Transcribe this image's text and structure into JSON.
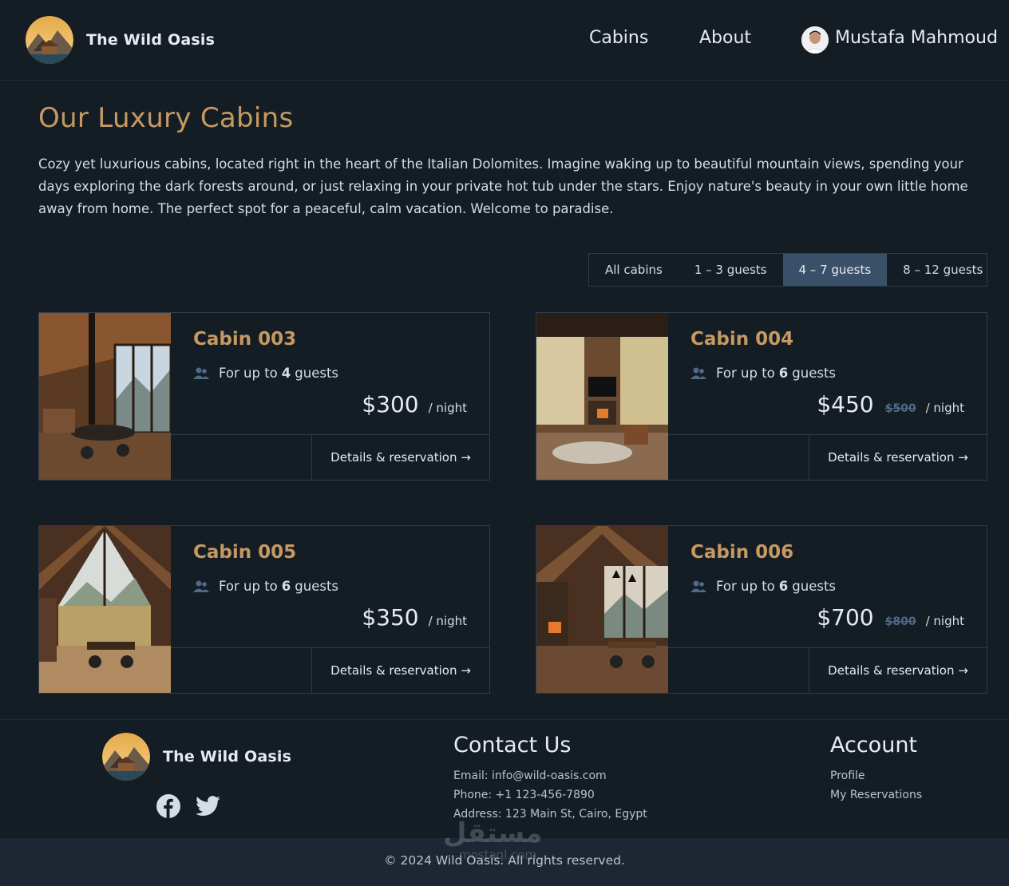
{
  "header": {
    "brand": "The Wild Oasis",
    "nav": [
      "Cabins",
      "About"
    ],
    "user": "Mustafa Mahmoud"
  },
  "main": {
    "title": "Our Luxury Cabins",
    "intro": "Cozy yet luxurious cabins, located right in the heart of the Italian Dolomites. Imagine waking up to beautiful mountain views, spending your days exploring the dark forests around, or just relaxing in your private hot tub under the stars. Enjoy nature's beauty in your own little home away from home. The perfect spot for a peaceful, calm vacation. Welcome to paradise.",
    "filters": [
      "All cabins",
      "1 – 3 guests",
      "4 – 7 guests",
      "8 – 12 guests"
    ],
    "active_filter": "4 – 7 guests",
    "cards": [
      {
        "name": "Cabin 003",
        "guests_prefix": "For up to",
        "guests": "4",
        "guests_suffix": "guests",
        "price": "$300",
        "old_price": "",
        "per": "/ night",
        "action": "Details & reservation →"
      },
      {
        "name": "Cabin 004",
        "guests_prefix": "For up to",
        "guests": "6",
        "guests_suffix": "guests",
        "price": "$450",
        "old_price": "$500",
        "per": "/ night",
        "action": "Details & reservation →"
      },
      {
        "name": "Cabin 005",
        "guests_prefix": "For up to",
        "guests": "6",
        "guests_suffix": "guests",
        "price": "$350",
        "old_price": "",
        "per": "/ night",
        "action": "Details & reservation →"
      },
      {
        "name": "Cabin 006",
        "guests_prefix": "For up to",
        "guests": "6",
        "guests_suffix": "guests",
        "price": "$700",
        "old_price": "$800",
        "per": "/ night",
        "action": "Details & reservation →"
      }
    ]
  },
  "footer": {
    "brand": "The Wild Oasis",
    "contact_title": "Contact Us",
    "contact": [
      "Email: info@wild-oasis.com",
      "Phone: +1 123-456-7890",
      "Address: 123 Main St, Cairo, Egypt"
    ],
    "account_title": "Account",
    "account_links": [
      "Profile",
      "My Reservations"
    ],
    "copyright": "© 2024 Wild Oasis. All rights reserved.",
    "watermark": "مستقل",
    "watermark_sub": "mostaql.com"
  },
  "colors": {
    "accent": "#c69963",
    "background": "#141c24",
    "border": "#2c3d4f",
    "active_filter": "#3a5068"
  },
  "icons": [
    "users-icon",
    "facebook-icon",
    "twitter-icon",
    "logo-icon",
    "user-avatar"
  ]
}
